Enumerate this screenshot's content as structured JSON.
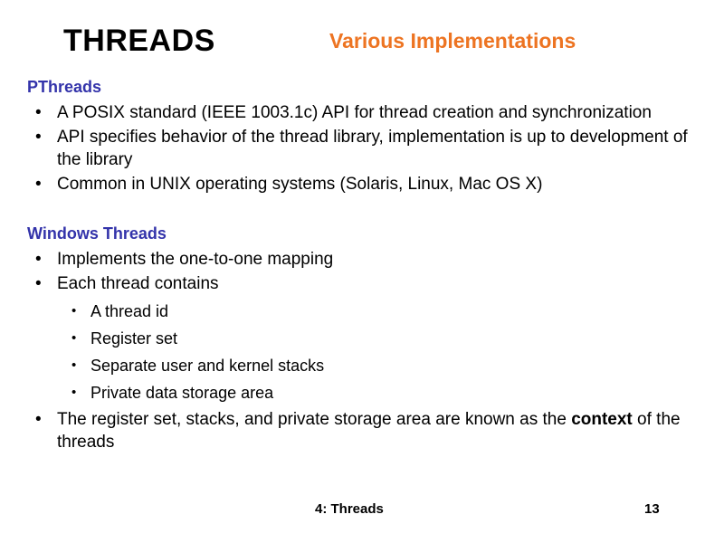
{
  "slide": {
    "main_title": "THREADS",
    "sub_title": "Various Implementations",
    "accent_orange": "#ED7422",
    "accent_blue": "#3333AA",
    "background": "#ffffff",
    "bullet_glyph": "•"
  },
  "sections": [
    {
      "heading": "PThreads",
      "bullets": [
        {
          "text": "A POSIX standard (IEEE 1003.1c) API for thread creation and synchronization"
        },
        {
          "text": "API specifies behavior of the thread library, implementation is up to development of the library"
        },
        {
          "text": "Common in UNIX operating systems (Solaris, Linux, Mac OS X)"
        }
      ]
    },
    {
      "heading": "Windows Threads",
      "bullets": [
        {
          "text": "Implements the one-to-one mapping"
        },
        {
          "text": "Each thread contains",
          "subbullets": [
            "A thread id",
            "Register set",
            "Separate user and kernel stacks",
            "Private data storage area"
          ]
        },
        {
          "text_before": "The register set, stacks, and private storage area are known as the ",
          "text_bold": "context",
          "text_after": " of the threads"
        }
      ]
    }
  ],
  "footer": {
    "left": "4: Threads",
    "right": "13"
  }
}
